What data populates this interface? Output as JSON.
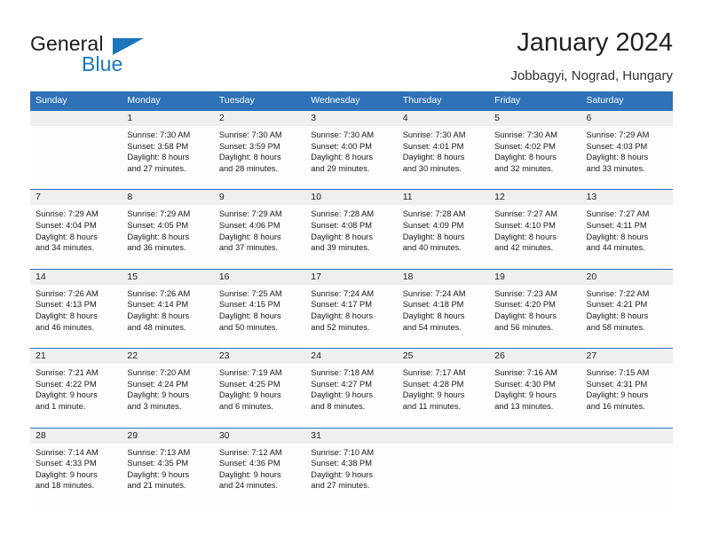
{
  "brand": {
    "name_part1": "General",
    "name_part2": "Blue",
    "logo_icon": "blue-triangle-logo"
  },
  "header": {
    "title": "January 2024",
    "location": "Jobbagyi, Nograd, Hungary"
  },
  "colors": {
    "header_blue": "#2e72b8",
    "brand_blue": "#1b75bb",
    "daynum_gray": "#efefef",
    "cell_white": "#fdfdfd"
  },
  "weekdays": [
    "Sunday",
    "Monday",
    "Tuesday",
    "Wednesday",
    "Thursday",
    "Friday",
    "Saturday"
  ],
  "weeks": [
    [
      {
        "day": "",
        "sunrise": "",
        "sunset": "",
        "daylight1": "",
        "daylight2": ""
      },
      {
        "day": "1",
        "sunrise": "Sunrise: 7:30 AM",
        "sunset": "Sunset: 3:58 PM",
        "daylight1": "Daylight: 8 hours",
        "daylight2": "and 27 minutes."
      },
      {
        "day": "2",
        "sunrise": "Sunrise: 7:30 AM",
        "sunset": "Sunset: 3:59 PM",
        "daylight1": "Daylight: 8 hours",
        "daylight2": "and 28 minutes."
      },
      {
        "day": "3",
        "sunrise": "Sunrise: 7:30 AM",
        "sunset": "Sunset: 4:00 PM",
        "daylight1": "Daylight: 8 hours",
        "daylight2": "and 29 minutes."
      },
      {
        "day": "4",
        "sunrise": "Sunrise: 7:30 AM",
        "sunset": "Sunset: 4:01 PM",
        "daylight1": "Daylight: 8 hours",
        "daylight2": "and 30 minutes."
      },
      {
        "day": "5",
        "sunrise": "Sunrise: 7:30 AM",
        "sunset": "Sunset: 4:02 PM",
        "daylight1": "Daylight: 8 hours",
        "daylight2": "and 32 minutes."
      },
      {
        "day": "6",
        "sunrise": "Sunrise: 7:29 AM",
        "sunset": "Sunset: 4:03 PM",
        "daylight1": "Daylight: 8 hours",
        "daylight2": "and 33 minutes."
      }
    ],
    [
      {
        "day": "7",
        "sunrise": "Sunrise: 7:29 AM",
        "sunset": "Sunset: 4:04 PM",
        "daylight1": "Daylight: 8 hours",
        "daylight2": "and 34 minutes."
      },
      {
        "day": "8",
        "sunrise": "Sunrise: 7:29 AM",
        "sunset": "Sunset: 4:05 PM",
        "daylight1": "Daylight: 8 hours",
        "daylight2": "and 36 minutes."
      },
      {
        "day": "9",
        "sunrise": "Sunrise: 7:29 AM",
        "sunset": "Sunset: 4:06 PM",
        "daylight1": "Daylight: 8 hours",
        "daylight2": "and 37 minutes."
      },
      {
        "day": "10",
        "sunrise": "Sunrise: 7:28 AM",
        "sunset": "Sunset: 4:08 PM",
        "daylight1": "Daylight: 8 hours",
        "daylight2": "and 39 minutes."
      },
      {
        "day": "11",
        "sunrise": "Sunrise: 7:28 AM",
        "sunset": "Sunset: 4:09 PM",
        "daylight1": "Daylight: 8 hours",
        "daylight2": "and 40 minutes."
      },
      {
        "day": "12",
        "sunrise": "Sunrise: 7:27 AM",
        "sunset": "Sunset: 4:10 PM",
        "daylight1": "Daylight: 8 hours",
        "daylight2": "and 42 minutes."
      },
      {
        "day": "13",
        "sunrise": "Sunrise: 7:27 AM",
        "sunset": "Sunset: 4:11 PM",
        "daylight1": "Daylight: 8 hours",
        "daylight2": "and 44 minutes."
      }
    ],
    [
      {
        "day": "14",
        "sunrise": "Sunrise: 7:26 AM",
        "sunset": "Sunset: 4:13 PM",
        "daylight1": "Daylight: 8 hours",
        "daylight2": "and 46 minutes."
      },
      {
        "day": "15",
        "sunrise": "Sunrise: 7:26 AM",
        "sunset": "Sunset: 4:14 PM",
        "daylight1": "Daylight: 8 hours",
        "daylight2": "and 48 minutes."
      },
      {
        "day": "16",
        "sunrise": "Sunrise: 7:25 AM",
        "sunset": "Sunset: 4:15 PM",
        "daylight1": "Daylight: 8 hours",
        "daylight2": "and 50 minutes."
      },
      {
        "day": "17",
        "sunrise": "Sunrise: 7:24 AM",
        "sunset": "Sunset: 4:17 PM",
        "daylight1": "Daylight: 8 hours",
        "daylight2": "and 52 minutes."
      },
      {
        "day": "18",
        "sunrise": "Sunrise: 7:24 AM",
        "sunset": "Sunset: 4:18 PM",
        "daylight1": "Daylight: 8 hours",
        "daylight2": "and 54 minutes."
      },
      {
        "day": "19",
        "sunrise": "Sunrise: 7:23 AM",
        "sunset": "Sunset: 4:20 PM",
        "daylight1": "Daylight: 8 hours",
        "daylight2": "and 56 minutes."
      },
      {
        "day": "20",
        "sunrise": "Sunrise: 7:22 AM",
        "sunset": "Sunset: 4:21 PM",
        "daylight1": "Daylight: 8 hours",
        "daylight2": "and 58 minutes."
      }
    ],
    [
      {
        "day": "21",
        "sunrise": "Sunrise: 7:21 AM",
        "sunset": "Sunset: 4:22 PM",
        "daylight1": "Daylight: 9 hours",
        "daylight2": "and 1 minute."
      },
      {
        "day": "22",
        "sunrise": "Sunrise: 7:20 AM",
        "sunset": "Sunset: 4:24 PM",
        "daylight1": "Daylight: 9 hours",
        "daylight2": "and 3 minutes."
      },
      {
        "day": "23",
        "sunrise": "Sunrise: 7:19 AM",
        "sunset": "Sunset: 4:25 PM",
        "daylight1": "Daylight: 9 hours",
        "daylight2": "and 6 minutes."
      },
      {
        "day": "24",
        "sunrise": "Sunrise: 7:18 AM",
        "sunset": "Sunset: 4:27 PM",
        "daylight1": "Daylight: 9 hours",
        "daylight2": "and 8 minutes."
      },
      {
        "day": "25",
        "sunrise": "Sunrise: 7:17 AM",
        "sunset": "Sunset: 4:28 PM",
        "daylight1": "Daylight: 9 hours",
        "daylight2": "and 11 minutes."
      },
      {
        "day": "26",
        "sunrise": "Sunrise: 7:16 AM",
        "sunset": "Sunset: 4:30 PM",
        "daylight1": "Daylight: 9 hours",
        "daylight2": "and 13 minutes."
      },
      {
        "day": "27",
        "sunrise": "Sunrise: 7:15 AM",
        "sunset": "Sunset: 4:31 PM",
        "daylight1": "Daylight: 9 hours",
        "daylight2": "and 16 minutes."
      }
    ],
    [
      {
        "day": "28",
        "sunrise": "Sunrise: 7:14 AM",
        "sunset": "Sunset: 4:33 PM",
        "daylight1": "Daylight: 9 hours",
        "daylight2": "and 18 minutes."
      },
      {
        "day": "29",
        "sunrise": "Sunrise: 7:13 AM",
        "sunset": "Sunset: 4:35 PM",
        "daylight1": "Daylight: 9 hours",
        "daylight2": "and 21 minutes."
      },
      {
        "day": "30",
        "sunrise": "Sunrise: 7:12 AM",
        "sunset": "Sunset: 4:36 PM",
        "daylight1": "Daylight: 9 hours",
        "daylight2": "and 24 minutes."
      },
      {
        "day": "31",
        "sunrise": "Sunrise: 7:10 AM",
        "sunset": "Sunset: 4:38 PM",
        "daylight1": "Daylight: 9 hours",
        "daylight2": "and 27 minutes."
      },
      {
        "day": "",
        "sunrise": "",
        "sunset": "",
        "daylight1": "",
        "daylight2": ""
      },
      {
        "day": "",
        "sunrise": "",
        "sunset": "",
        "daylight1": "",
        "daylight2": ""
      },
      {
        "day": "",
        "sunrise": "",
        "sunset": "",
        "daylight1": "",
        "daylight2": ""
      }
    ]
  ]
}
